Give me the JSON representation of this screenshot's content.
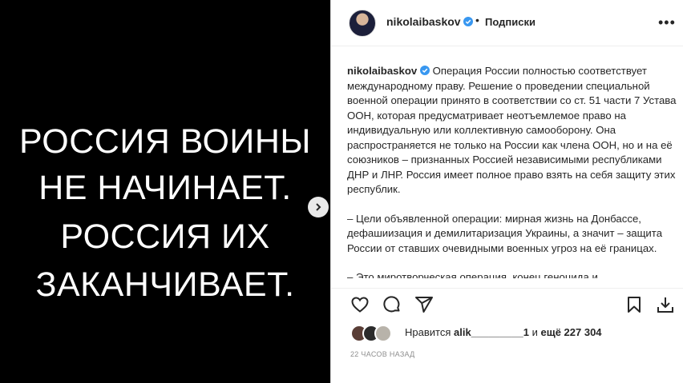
{
  "media": {
    "lines": [
      "РОССИЯ ВОИНЫ",
      "НЕ НАЧИНАЕТ.",
      "РОССИЯ ИХ",
      "ЗАКАНЧИВАЕТ."
    ]
  },
  "header": {
    "username": "nikolaibaskov",
    "separator": "•",
    "follow_label": "Подписки",
    "more_label": "•••"
  },
  "caption": {
    "username": "nikolaibaskov",
    "paragraphs": [
      "Операция России полностью соответствует международному праву. Решение о проведении специальной военной операции принято в соответствии со ст. 51 части 7 Устава ООН, которая предусматривает неотъемлемое право на индивидуальную или коллективную самооборону. Она распространяется не только на России как члена ООН, но и на её союзников – признанных Россией независимыми республиками ДНР и ЛНР. Россия имеет полное право взять на себя защиту этих республик.",
      "– Цели объявленной операции: мирная жизнь на Донбассе, дефашиизация и демилитаризация Украины, а значит – защита России от ставших очевидными военных угроз на её границах.",
      "– Это миротворческая операция, конец геноцида и"
    ]
  },
  "likes": {
    "prefix": "Нравится",
    "user": "alik_________1",
    "middle": "и",
    "count_text": "ещё 227 304"
  },
  "time": "22 ЧАСОВ НАЗАД",
  "colors": {
    "verified": "#3897f0",
    "text": "#262626",
    "muted": "#8e8e8e"
  }
}
